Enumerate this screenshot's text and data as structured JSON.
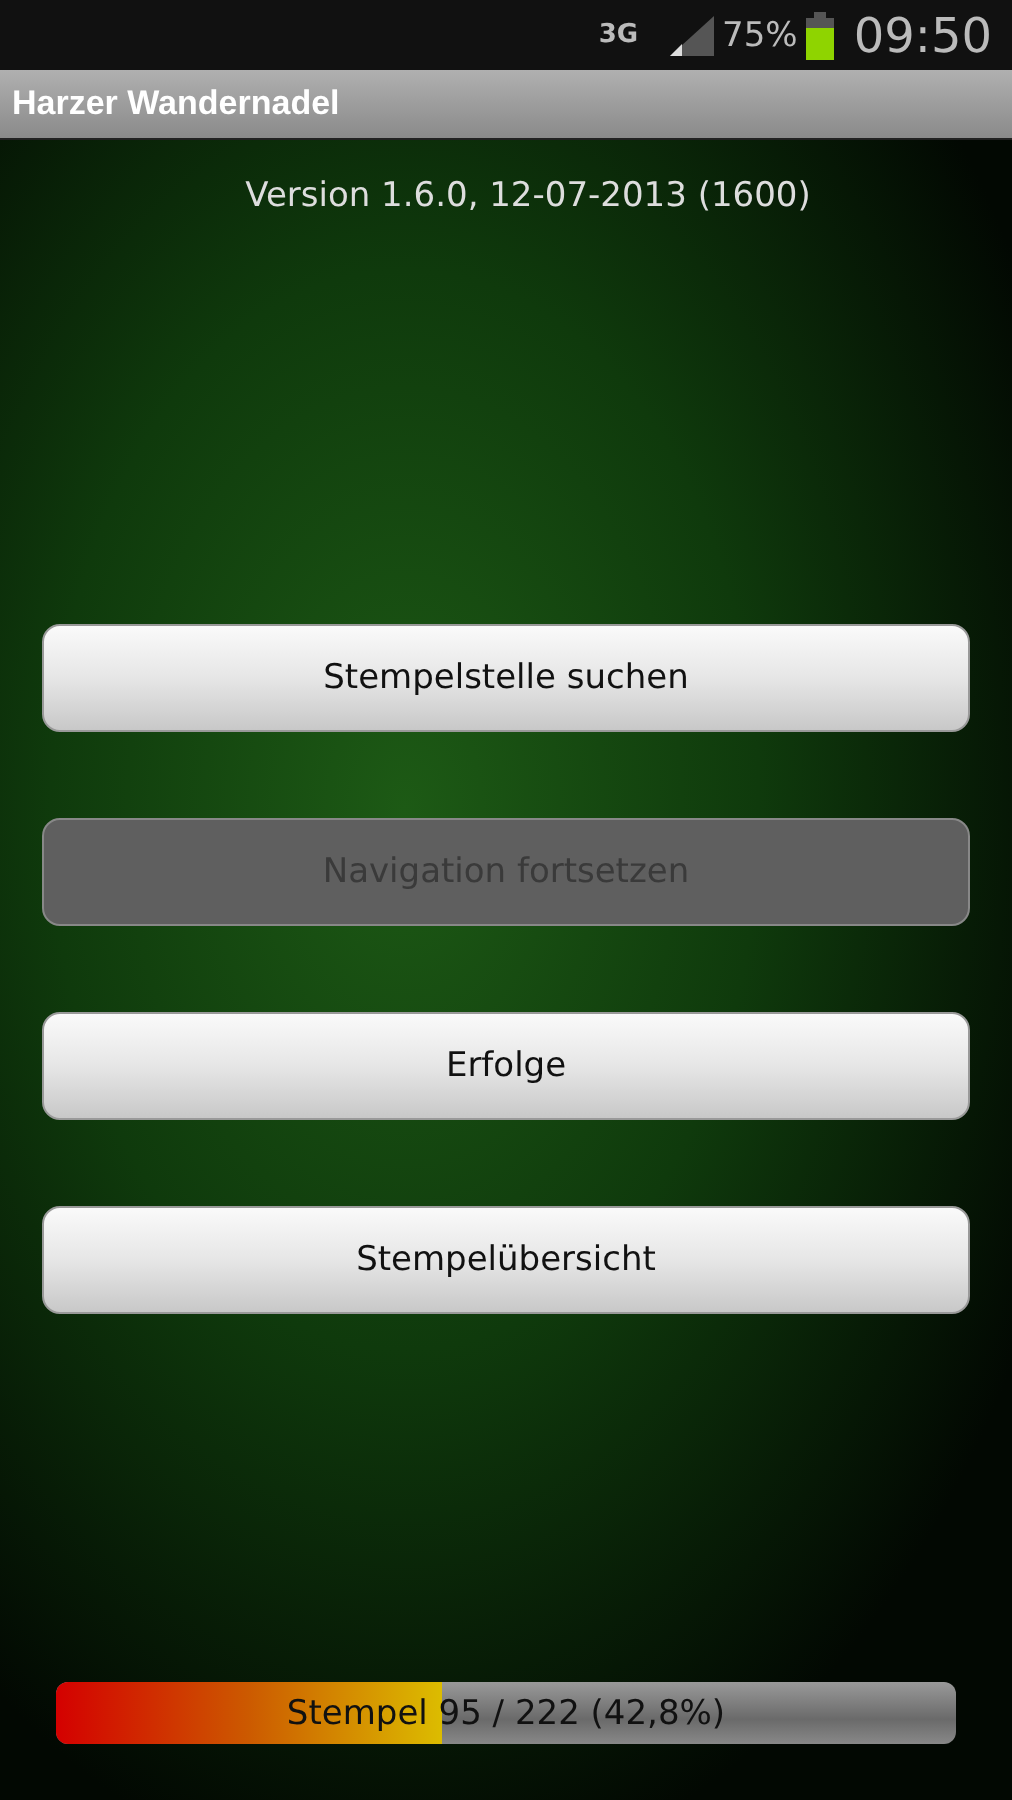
{
  "status_bar": {
    "network": "3G",
    "battery_percent": "75%",
    "time": "09:50"
  },
  "app_bar": {
    "title": "Harzer Wandernadel"
  },
  "version": "Version 1.6.0, 12-07-2013 (1600)",
  "buttons": [
    {
      "label": "Stempelstelle suchen",
      "disabled": false
    },
    {
      "label": "Navigation fortsetzen",
      "disabled": true
    },
    {
      "label": "Erfolge",
      "disabled": false
    },
    {
      "label": "Stempelübersicht",
      "disabled": false
    }
  ],
  "progress": {
    "label": "Stempel 95 / 222 (42,8%)",
    "level": 0.428
  }
}
